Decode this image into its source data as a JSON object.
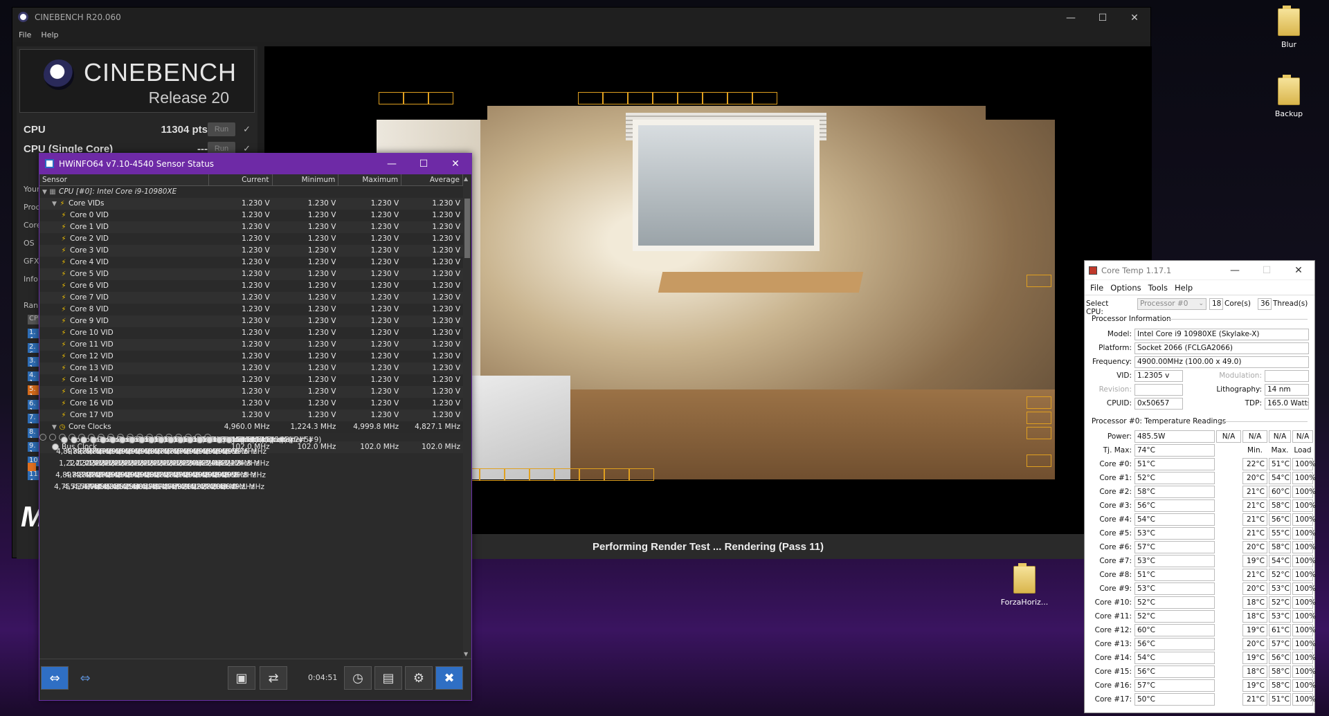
{
  "cinebench": {
    "title": "CINEBENCH R20.060",
    "menu": [
      "File",
      "Help"
    ],
    "brand_name": "CINEBENCH",
    "brand_release": "Release 20",
    "cpu_label": "CPU",
    "cpu_score": "11304 pts",
    "cpu_single_label": "CPU (Single Core)",
    "cpu_single_score": "---",
    "run_label": "Run",
    "side_labels": [
      "Your",
      "Proc",
      "Core",
      "OS",
      "GFX",
      "Info"
    ],
    "rank_label": "Rank",
    "rank_tab": "CPU",
    "rank_items": [
      "1. 4",
      "2. 6",
      "3. 1",
      "4. 1",
      "5. 1",
      "6. 1",
      "7. 1",
      "8. 1",
      "9. 1",
      "10. 4",
      "11. 4"
    ],
    "rank_footer": "Y",
    "status": "Performing Render Test ... Rendering (Pass 11)"
  },
  "desktop": {
    "icons": [
      "Blur",
      "Backup",
      "ForzaHoriz..."
    ]
  },
  "hwinfo": {
    "title": "HWiNFO64 v7.10-4540 Sensor Status",
    "columns": [
      "Sensor",
      "Current",
      "Minimum",
      "Maximum",
      "Average"
    ],
    "rows": [
      {
        "kind": "cpuhead",
        "name": "CPU [#0]: Intel Core i9-10980XE",
        "v": [
          "",
          "",
          "",
          ""
        ]
      },
      {
        "kind": "group",
        "name": "Core VIDs",
        "v": [
          "1.230 V",
          "1.230 V",
          "1.230 V",
          "1.230 V"
        ]
      },
      {
        "kind": "vid",
        "name": "Core 0 VID",
        "v": [
          "1.230 V",
          "1.230 V",
          "1.230 V",
          "1.230 V"
        ]
      },
      {
        "kind": "vid",
        "name": "Core 1 VID",
        "v": [
          "1.230 V",
          "1.230 V",
          "1.230 V",
          "1.230 V"
        ]
      },
      {
        "kind": "vid",
        "name": "Core 2 VID",
        "v": [
          "1.230 V",
          "1.230 V",
          "1.230 V",
          "1.230 V"
        ]
      },
      {
        "kind": "vid",
        "name": "Core 3 VID",
        "v": [
          "1.230 V",
          "1.230 V",
          "1.230 V",
          "1.230 V"
        ]
      },
      {
        "kind": "vid",
        "name": "Core 4 VID",
        "v": [
          "1.230 V",
          "1.230 V",
          "1.230 V",
          "1.230 V"
        ]
      },
      {
        "kind": "vid",
        "name": "Core 5 VID",
        "v": [
          "1.230 V",
          "1.230 V",
          "1.230 V",
          "1.230 V"
        ]
      },
      {
        "kind": "vid",
        "name": "Core 6 VID",
        "v": [
          "1.230 V",
          "1.230 V",
          "1.230 V",
          "1.230 V"
        ]
      },
      {
        "kind": "vid",
        "name": "Core 7 VID",
        "v": [
          "1.230 V",
          "1.230 V",
          "1.230 V",
          "1.230 V"
        ]
      },
      {
        "kind": "vid",
        "name": "Core 8 VID",
        "v": [
          "1.230 V",
          "1.230 V",
          "1.230 V",
          "1.230 V"
        ]
      },
      {
        "kind": "vid",
        "name": "Core 9 VID",
        "v": [
          "1.230 V",
          "1.230 V",
          "1.230 V",
          "1.230 V"
        ]
      },
      {
        "kind": "vid",
        "name": "Core 10 VID",
        "v": [
          "1.230 V",
          "1.230 V",
          "1.230 V",
          "1.230 V"
        ]
      },
      {
        "kind": "vid",
        "name": "Core 11 VID",
        "v": [
          "1.230 V",
          "1.230 V",
          "1.230 V",
          "1.230 V"
        ]
      },
      {
        "kind": "vid",
        "name": "Core 12 VID",
        "v": [
          "1.230 V",
          "1.230 V",
          "1.230 V",
          "1.230 V"
        ]
      },
      {
        "kind": "vid",
        "name": "Core 13 VID",
        "v": [
          "1.230 V",
          "1.230 V",
          "1.230 V",
          "1.230 V"
        ]
      },
      {
        "kind": "vid",
        "name": "Core 14 VID",
        "v": [
          "1.230 V",
          "1.230 V",
          "1.230 V",
          "1.230 V"
        ]
      },
      {
        "kind": "vid",
        "name": "Core 15 VID",
        "v": [
          "1.230 V",
          "1.230 V",
          "1.230 V",
          "1.230 V"
        ]
      },
      {
        "kind": "vid",
        "name": "Core 16 VID",
        "v": [
          "1.230 V",
          "1.230 V",
          "1.230 V",
          "1.230 V"
        ]
      },
      {
        "kind": "vid",
        "name": "Core 17 VID",
        "v": [
          "1.230 V",
          "1.230 V",
          "1.230 V",
          "1.230 V"
        ]
      },
      {
        "kind": "group",
        "name": "Core Clocks",
        "v": [
          "4,960.0 MHz",
          "1,224.3 MHz",
          "4,999.8 MHz",
          "4,827.1 MHz"
        ]
      },
      {
        "kind": "clk",
        "name": "Core 0 Clock (perf #18)",
        "v": [
          "4,897.6 MHz",
          "1,224.3 MHz",
          "4,897.8 MHz",
          "4,755.3 MHz"
        ]
      },
      {
        "kind": "clk",
        "name": "Core 1 Clock (perf #17)",
        "v": [
          "4,897.6 MHz",
          "1,224.3 MHz",
          "4,897.8 MHz",
          "4,755.7 MHz"
        ]
      },
      {
        "kind": "clk",
        "name": "Core 2 Clock (perf #12)",
        "v": [
          "4,897.6 MHz",
          "1,224.3 MHz",
          "4,897.8 MHz",
          "4,760.4 MHz"
        ]
      },
      {
        "kind": "clk",
        "name": "Core 3 Clock (perf #13)",
        "v": [
          "4,897.6 MHz",
          "1,224.3 MHz",
          "4,897.8 MHz",
          "4,765.5 MHz"
        ]
      },
      {
        "kind": "clk",
        "name": "Core 4 Clock (perf #6)",
        "v": [
          "4,999.6 MHz",
          "1,224.3 MHz",
          "4,999.8 MHz",
          "4,863.3 MHz"
        ]
      },
      {
        "kind": "clk",
        "name": "Core 5 Clock (perf #11)",
        "v": [
          "4,999.6 MHz",
          "1,224.3 MHz",
          "4,999.8 MHz",
          "4,885.2 MHz"
        ]
      },
      {
        "kind": "clk",
        "name": "Core 6 Clock (perf #3)",
        "v": [
          "4,999.6 MHz",
          "1,224.3 MHz",
          "4,999.8 MHz",
          "4,875.4 MHz"
        ]
      },
      {
        "kind": "clk",
        "name": "Core 7 Clock (perf #4)",
        "v": [
          "4,999.6 MHz",
          "1,224.3 MHz",
          "4,999.8 MHz",
          "4,860.1 MHz"
        ]
      },
      {
        "kind": "clk",
        "name": "Core 8 Clock (perf #7)",
        "v": [
          "4,999.6 MHz",
          "1,224.3 MHz",
          "4,999.8 MHz",
          "4,858.9 MHz"
        ]
      },
      {
        "kind": "clk",
        "name": "Core 9 Clock (perf #15)",
        "v": [
          "4,897.6 MHz",
          "1,224.3 MHz",
          "4,897.8 MHz",
          "4,762.8 MHz"
        ]
      },
      {
        "kind": "clk",
        "name": "Core 10 Clock (perf #16)",
        "v": [
          "4,897.6 MHz",
          "1,224.3 MHz",
          "4,897.8 MHz",
          "4,748.7 MHz"
        ]
      },
      {
        "kind": "clk",
        "name": "Core 11 Clock (perf #14)",
        "v": [
          "4,897.6 MHz",
          "1,224.3 MHz",
          "4,897.8 MHz",
          "4,769.9 MHz"
        ]
      },
      {
        "kind": "clk",
        "name": "Core 12 Clock (perf #1)",
        "v": [
          "4,999.6 MHz",
          "1,224.3 MHz",
          "4,999.8 MHz",
          "4,871.1 MHz"
        ]
      },
      {
        "kind": "clk",
        "name": "Core 13 Clock (perf #10)",
        "v": [
          "4,999.6 MHz",
          "3,060.1 MHz",
          "4,999.8 MHz",
          "4,892.3 MHz"
        ]
      },
      {
        "kind": "clk",
        "name": "Core 14 Clock (perf #8)",
        "v": [
          "4,999.6 MHz",
          "1,224.3 MHz",
          "4,999.8 MHz",
          "4,877.8 MHz"
        ]
      },
      {
        "kind": "clk",
        "name": "Core 15 Clock (perf #2)",
        "v": [
          "4,999.6 MHz",
          "3,060.1 MHz",
          "4,999.8 MHz",
          "4,870.3 MHz"
        ]
      },
      {
        "kind": "clk",
        "name": "Core 16 Clock (perf #5)",
        "v": [
          "4,999.6 MHz",
          "1,224.3 MHz",
          "4,999.8 MHz",
          "4,866.0 MHz"
        ]
      },
      {
        "kind": "clk",
        "name": "Core 17 Clock (perf #9)",
        "v": [
          "4,999.6 MHz",
          "1,224.3 MHz",
          "4,999.8 MHz",
          "4,849.1 MHz"
        ]
      },
      {
        "kind": "bus",
        "name": "Bus Clock",
        "v": [
          "102.0 MHz",
          "102.0 MHz",
          "102.0 MHz",
          "102.0 MHz"
        ]
      }
    ],
    "timer": "0:04:51"
  },
  "coretemp": {
    "title": "Core Temp 1.17.1",
    "menu": [
      "File",
      "Options",
      "Tools",
      "Help"
    ],
    "select_cpu_label": "Select CPU:",
    "processor_select": "Processor #0",
    "cores_count": "18",
    "cores_label": "Core(s)",
    "threads_count": "36",
    "threads_label": "Thread(s)",
    "proc_info_label": "Processor Information",
    "model_label": "Model:",
    "model": "Intel Core i9 10980XE (Skylake-X)",
    "platform_label": "Platform:",
    "platform": "Socket 2066 (FCLGA2066)",
    "frequency_label": "Frequency:",
    "frequency": "4900.00MHz (100.00 x 49.0)",
    "vid_label": "VID:",
    "vid": "1.2305 v",
    "modulation_label": "Modulation:",
    "revision_label": "Revision:",
    "lithography_label": "Lithography:",
    "lithography": "14 nm",
    "cpuid_label": "CPUID:",
    "cpuid": "0x50657",
    "tdp_label": "TDP:",
    "tdp": "165.0 Watts",
    "temp_readings_label": "Processor #0: Temperature Readings",
    "power_label": "Power:",
    "power": "485.5W",
    "power_na": [
      "N/A",
      "N/A",
      "N/A",
      "N/A"
    ],
    "tjmax_label": "Tj. Max:",
    "tjmax": "74°C",
    "col_min": "Min.",
    "col_max": "Max.",
    "col_load": "Load",
    "cores": [
      {
        "label": "Core #0:",
        "temp": "51°C",
        "min": "22°C",
        "max": "51°C",
        "load": "100%"
      },
      {
        "label": "Core #1:",
        "temp": "52°C",
        "min": "20°C",
        "max": "54°C",
        "load": "100%"
      },
      {
        "label": "Core #2:",
        "temp": "58°C",
        "min": "21°C",
        "max": "60°C",
        "load": "100%"
      },
      {
        "label": "Core #3:",
        "temp": "56°C",
        "min": "21°C",
        "max": "58°C",
        "load": "100%"
      },
      {
        "label": "Core #4:",
        "temp": "54°C",
        "min": "21°C",
        "max": "56°C",
        "load": "100%"
      },
      {
        "label": "Core #5:",
        "temp": "53°C",
        "min": "21°C",
        "max": "55°C",
        "load": "100%"
      },
      {
        "label": "Core #6:",
        "temp": "57°C",
        "min": "20°C",
        "max": "58°C",
        "load": "100%"
      },
      {
        "label": "Core #7:",
        "temp": "53°C",
        "min": "19°C",
        "max": "54°C",
        "load": "100%"
      },
      {
        "label": "Core #8:",
        "temp": "51°C",
        "min": "21°C",
        "max": "52°C",
        "load": "100%"
      },
      {
        "label": "Core #9:",
        "temp": "53°C",
        "min": "20°C",
        "max": "53°C",
        "load": "100%"
      },
      {
        "label": "Core #10:",
        "temp": "52°C",
        "min": "18°C",
        "max": "52°C",
        "load": "100%"
      },
      {
        "label": "Core #11:",
        "temp": "52°C",
        "min": "18°C",
        "max": "53°C",
        "load": "100%"
      },
      {
        "label": "Core #12:",
        "temp": "60°C",
        "min": "19°C",
        "max": "61°C",
        "load": "100%"
      },
      {
        "label": "Core #13:",
        "temp": "56°C",
        "min": "20°C",
        "max": "57°C",
        "load": "100%"
      },
      {
        "label": "Core #14:",
        "temp": "54°C",
        "min": "19°C",
        "max": "56°C",
        "load": "100%"
      },
      {
        "label": "Core #15:",
        "temp": "56°C",
        "min": "18°C",
        "max": "58°C",
        "load": "100%"
      },
      {
        "label": "Core #16:",
        "temp": "57°C",
        "min": "19°C",
        "max": "58°C",
        "load": "100%"
      },
      {
        "label": "Core #17:",
        "temp": "50°C",
        "min": "21°C",
        "max": "51°C",
        "load": "100%"
      }
    ]
  },
  "colors": {
    "hwinfo_title": "#6e2aa6",
    "bucket_outline": "#e0a020",
    "bolt": "#f2c200",
    "rank_bar": "#2e6db5"
  }
}
